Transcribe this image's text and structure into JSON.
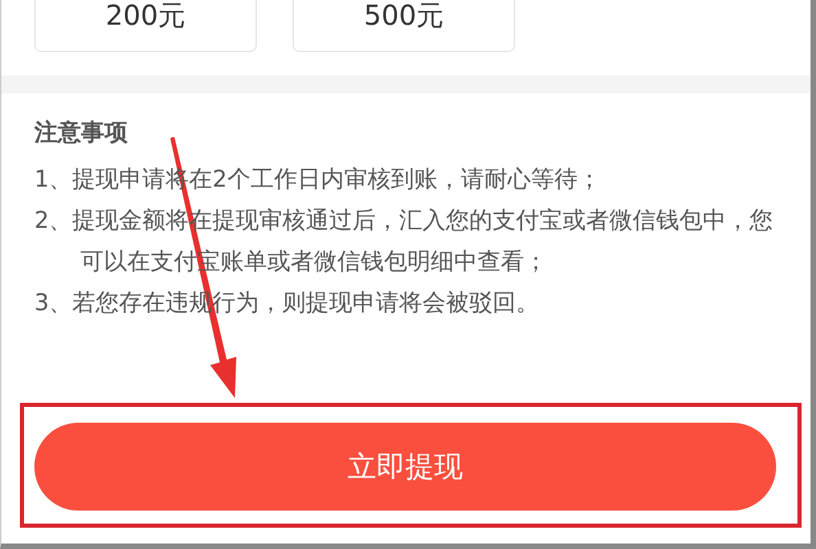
{
  "amount_options": [
    {
      "label": "200元"
    },
    {
      "label": "500元"
    }
  ],
  "notice": {
    "title": "注意事项",
    "items": [
      "1、提现申请将在2个工作日内审核到账，请耐心等待；",
      "2、提现金额将在提现审核通过后，汇入您的支付宝或者微信钱包中，您可以在支付宝账单或者微信钱包明细中查看；",
      "3、若您存在违规行为，则提现申请将会被驳回。"
    ]
  },
  "submit_button": {
    "label": "立即提现"
  }
}
